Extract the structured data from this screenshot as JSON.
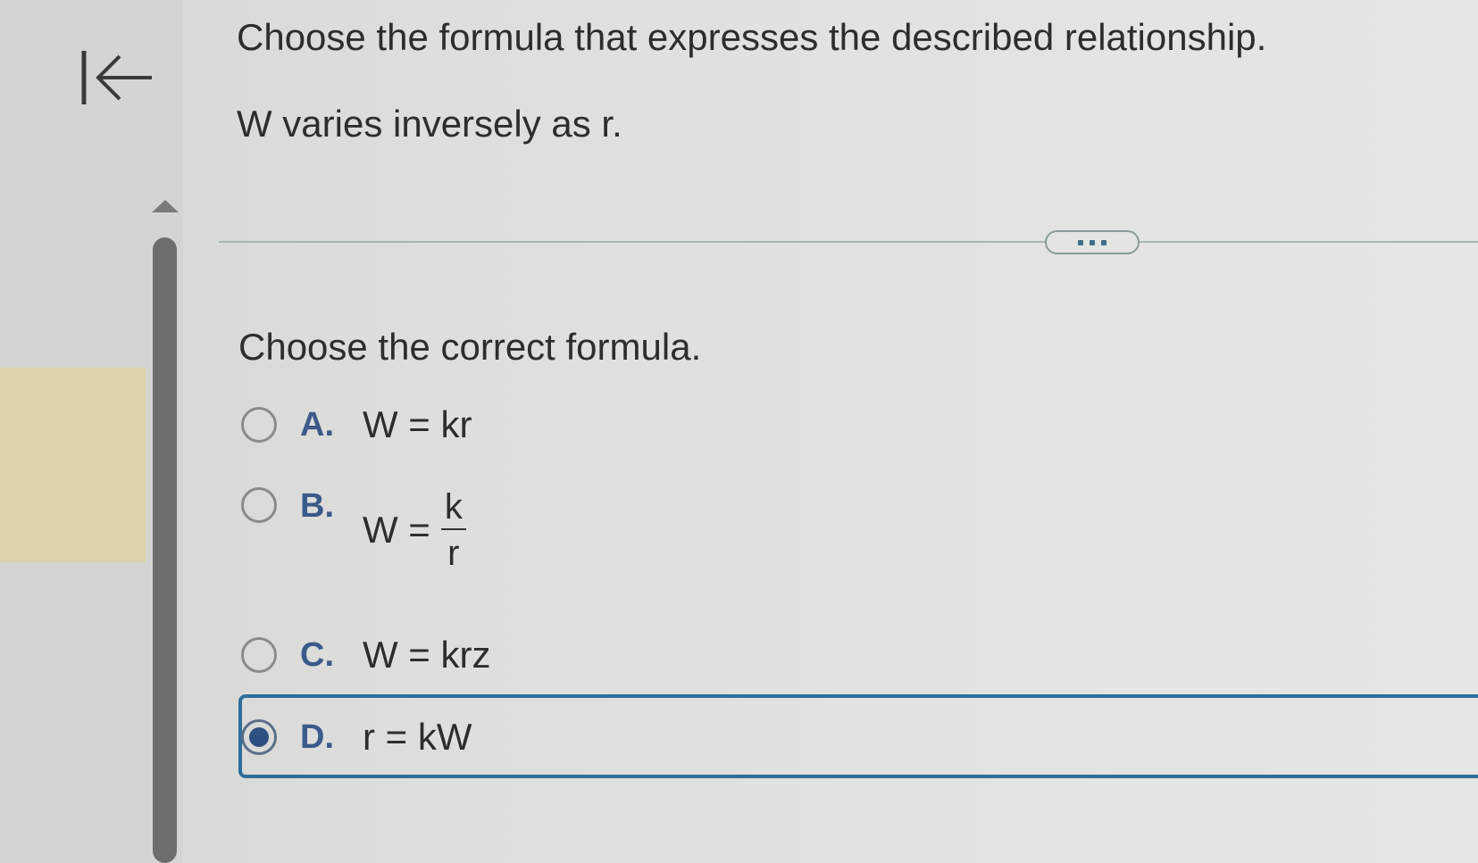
{
  "question": {
    "title": "Choose the formula that expresses the described relationship.",
    "statement": "W varies inversely as r.",
    "prompt": "Choose the correct formula."
  },
  "nav": {
    "back_icon": "first-page-arrow-icon"
  },
  "more_button": {
    "icon": "ellipsis-icon"
  },
  "options": [
    {
      "letter": "A.",
      "formula": "W = kr",
      "selected": false
    },
    {
      "letter": "B.",
      "formula_lhs": "W =",
      "numerator": "k",
      "denominator": "r",
      "selected": false
    },
    {
      "letter": "C.",
      "formula": "W = krz",
      "selected": false
    },
    {
      "letter": "D.",
      "formula": "r = kW",
      "selected": true
    }
  ],
  "colors": {
    "accent": "#2e6e9a",
    "letter": "#3a5a8a",
    "radio_selected": "#2e4f82",
    "left_highlight": "#ddd3a8"
  }
}
